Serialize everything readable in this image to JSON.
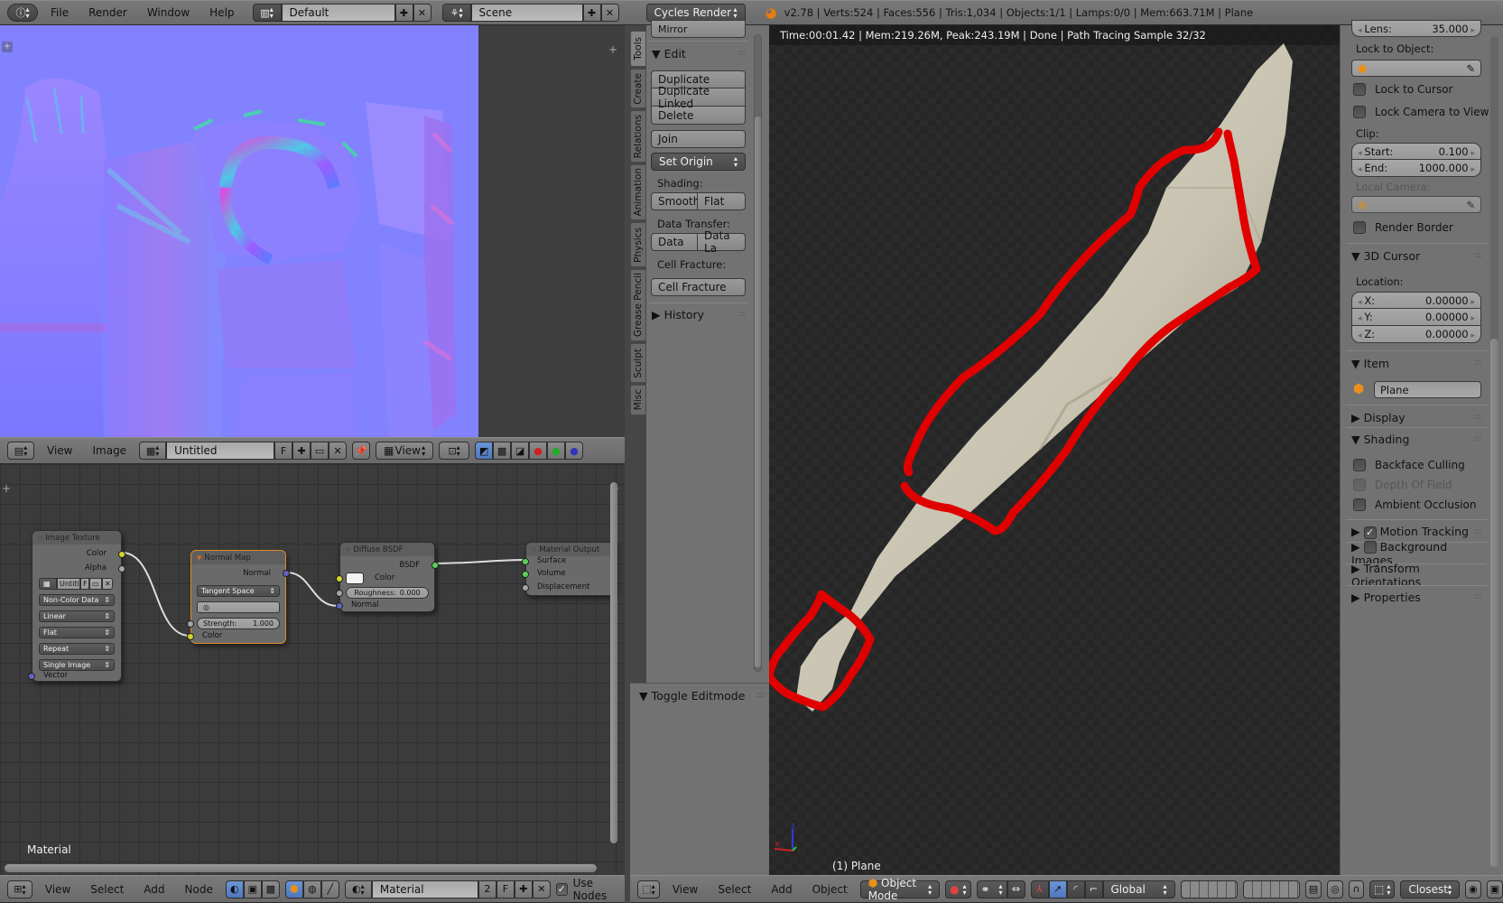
{
  "top_bar": {
    "menus": [
      "File",
      "Render",
      "Window",
      "Help"
    ],
    "screen_layout": "Default",
    "scene": "Scene",
    "render_engine": "Cycles Render",
    "stats": "v2.78 | Verts:524 | Faces:556 | Tris:1,034 | Objects:1/1 | Lamps:0/0 | Mem:663.71M | Plane"
  },
  "image_editor": {
    "menus": [
      "View",
      "Image"
    ],
    "image_name": "Untitled",
    "fake_user": "F",
    "view_mode": "View"
  },
  "node_editor": {
    "menus": [
      "View",
      "Select",
      "Add",
      "Node"
    ],
    "material_name": "Material",
    "users": "2",
    "fake_user": "F",
    "use_nodes_label": "Use Nodes",
    "use_nodes": true,
    "overlay_label": "Material",
    "nodes": {
      "image_texture": {
        "title": "Image Texture",
        "outputs": [
          "Color",
          "Alpha"
        ],
        "image": "Untitl",
        "image_f": "F",
        "color_space": "Non-Color Data",
        "interpolation": "Linear",
        "projection": "Flat",
        "extension": "Repeat",
        "source": "Single Image",
        "input": "Vector"
      },
      "normal_map": {
        "title": "Normal Map",
        "output": "Normal",
        "space": "Tangent Space",
        "strength_label": "Strength:",
        "strength": "1.000",
        "input": "Color"
      },
      "diffuse_bsdf": {
        "title": "Diffuse BSDF",
        "output": "BSDF",
        "color_label": "Color",
        "roughness_label": "Roughness:",
        "roughness": "0.000",
        "normal_label": "Normal"
      },
      "material_output": {
        "title": "Material Output",
        "inputs": [
          "Surface",
          "Volume",
          "Displacement"
        ]
      }
    }
  },
  "tool_shelf": {
    "tabs": [
      "Tools",
      "Create",
      "Relations",
      "Animation",
      "Physics",
      "Grease Pencil",
      "Sculpt",
      "Misc"
    ],
    "active_tab": "Tools",
    "mirror_label": "Mirror",
    "edit_header": "Edit",
    "buttons": [
      "Duplicate",
      "Duplicate Linked",
      "Delete"
    ],
    "join": "Join",
    "set_origin": "Set Origin",
    "shading_label": "Shading:",
    "smooth": "Smooth",
    "flat": "Flat",
    "data_transfer_label": "Data Transfer:",
    "data": "Data",
    "data_layout": "Data La",
    "cell_fracture_label": "Cell Fracture:",
    "cell_fracture": "Cell Fracture",
    "history": "History",
    "toggle_editmode": "Toggle Editmode"
  },
  "viewport": {
    "render_status": "Time:00:01.42 | Mem:219.26M, Peak:243.19M | Done | Path Tracing Sample 32/32",
    "object_label": "(1) Plane",
    "annotation_color": "#e00000",
    "menus": [
      "View",
      "Select",
      "Add",
      "Object"
    ],
    "mode": "Object Mode",
    "orientation": "Global",
    "snap": "Closest"
  },
  "properties": {
    "lens_label": "Lens:",
    "lens": "35.000",
    "lock_to_object_label": "Lock to Object:",
    "lock_to_cursor": "Lock to Cursor",
    "lock_camera_to_view": "Lock Camera to View",
    "clip_label": "Clip:",
    "clip_start_label": "Start:",
    "clip_start": "0.100",
    "clip_end_label": "End:",
    "clip_end": "1000.000",
    "local_camera_label": "Local Camera:",
    "render_border": "Render Border",
    "cursor_header": "3D Cursor",
    "location_label": "Location:",
    "cursor": [
      {
        "axis": "X:",
        "value": "0.00000"
      },
      {
        "axis": "Y:",
        "value": "0.00000"
      },
      {
        "axis": "Z:",
        "value": "0.00000"
      }
    ],
    "item_header": "Item",
    "item_name": "Plane",
    "display_header": "Display",
    "shading_header": "Shading",
    "backface_culling": "Backface Culling",
    "depth_of_field": "Depth Of Field",
    "ambient_occlusion": "Ambient Occlusion",
    "motion_tracking": "Motion Tracking",
    "motion_tracking_checked": true,
    "background_images": "Background Images",
    "transform_orientations": "Transform Orientations",
    "properties_header": "Properties"
  }
}
